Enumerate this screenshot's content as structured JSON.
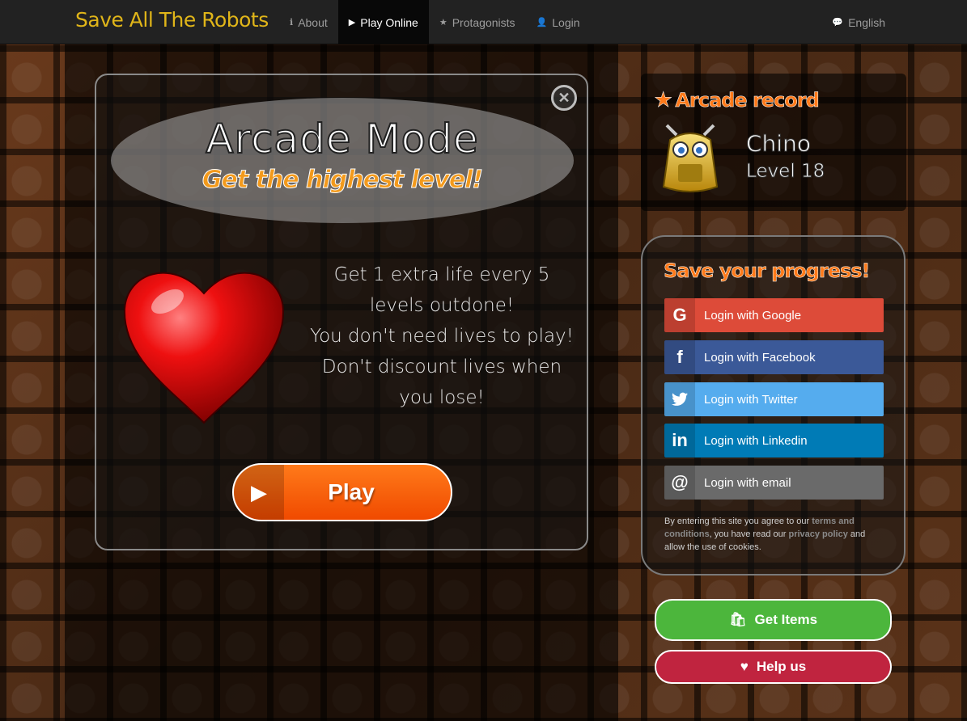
{
  "navbar": {
    "brand": "Save All The Robots",
    "links": [
      {
        "label": "About",
        "icon": "info-icon"
      },
      {
        "label": "Play Online",
        "icon": "play-icon",
        "active": true
      },
      {
        "label": "Protagonists",
        "icon": "star-icon"
      },
      {
        "label": "Login",
        "icon": "user-icon"
      }
    ],
    "language": {
      "label": "English",
      "icon": "chat-icon"
    }
  },
  "arcade": {
    "title": "Arcade Mode",
    "subtitle": "Get the highest level!",
    "description": [
      "Get 1 extra life every 5 levels outdone!",
      "You don't need lives to play!",
      "Don't discount lives when you lose!"
    ],
    "play_label": "Play"
  },
  "record": {
    "title": "Arcade record",
    "name": "Chino",
    "level": "Level 18"
  },
  "save": {
    "title": "Save your progress!",
    "buttons": [
      {
        "label": "Login with Google",
        "icon": "google-icon",
        "glyph": "G"
      },
      {
        "label": "Login with Facebook",
        "icon": "facebook-icon",
        "glyph": "f"
      },
      {
        "label": "Login with Twitter",
        "icon": "twitter-icon",
        "glyph": "🐦"
      },
      {
        "label": "Login with Linkedin",
        "icon": "linkedin-icon",
        "glyph": "in"
      },
      {
        "label": "Login with email",
        "icon": "at-icon",
        "glyph": "@"
      }
    ],
    "legal": {
      "prefix": "By entering this site you agree to our",
      "terms": "terms and conditions",
      "middle": ", you have read our",
      "privacy": "privacy policy",
      "suffix": "and allow the use of cookies."
    }
  },
  "actions": {
    "items_label": "Get Items",
    "help_label": "Help us"
  },
  "colors": {
    "brand": "#e0b519",
    "accent_orange": "#ff7a1a",
    "google": "#dd4b39",
    "facebook": "#3b5998",
    "twitter": "#55acee",
    "linkedin": "#007bb6",
    "email": "#6a6a6a",
    "items": "#4cb63c",
    "help": "#c0243f"
  }
}
